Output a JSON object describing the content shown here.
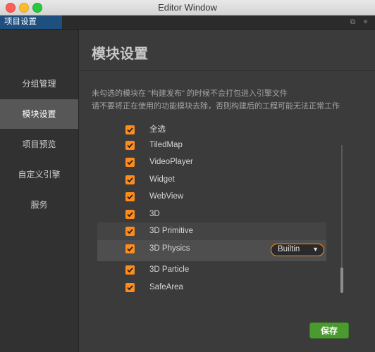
{
  "window": {
    "title": "Editor Window"
  },
  "tabbar": {
    "active_tab": "项目设置"
  },
  "sidebar": {
    "items": [
      {
        "label": "分组管理",
        "active": false
      },
      {
        "label": "模块设置",
        "active": true
      },
      {
        "label": "项目预览",
        "active": false
      },
      {
        "label": "自定义引擎",
        "active": false
      },
      {
        "label": "服务",
        "active": false
      }
    ]
  },
  "main": {
    "title": "模块设置",
    "desc_line1": "未勾选的模块在 \"构建发布\" 的时候不会打包进入引擎文件",
    "desc_line2": "请不要将正在使用的功能模块去除，否则构建后的工程可能无法正常工作",
    "modules": [
      {
        "label": "全选",
        "checked": true
      },
      {
        "label": "TiledMap",
        "checked": true
      },
      {
        "label": "VideoPlayer",
        "checked": true
      },
      {
        "label": "Widget",
        "checked": true
      },
      {
        "label": "WebView",
        "checked": true
      },
      {
        "label": "3D",
        "checked": true
      },
      {
        "label": "3D Primitive",
        "checked": true
      },
      {
        "label": "3D Physics",
        "checked": true
      },
      {
        "label": "3D Particle",
        "checked": true
      },
      {
        "label": "SafeArea",
        "checked": true
      }
    ],
    "physics_backend": {
      "selected": "Builtin"
    },
    "save_label": "保存"
  },
  "colors": {
    "accent": "#ff8c1a",
    "save_button": "#4b9a2f",
    "active_tab": "#1f4f7f"
  }
}
